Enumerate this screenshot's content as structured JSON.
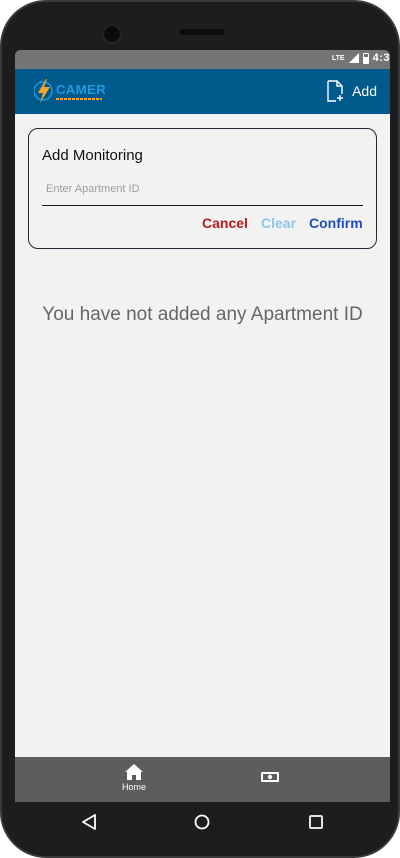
{
  "status_bar": {
    "network_label": "LTE",
    "time": "4:3"
  },
  "app_bar": {
    "logo_text": "CAMER",
    "add_label": "Add"
  },
  "add_monitoring": {
    "title": "Add Monitoring",
    "input_placeholder": "Enter Apartment ID",
    "input_value": "",
    "cancel_label": "Cancel",
    "clear_label": "Clear",
    "confirm_label": "Confirm"
  },
  "empty_state": {
    "message": "You have not added any Apartment ID"
  },
  "bottom_nav": {
    "items": [
      {
        "label": "Home",
        "icon": "home-icon"
      },
      {
        "label": "",
        "icon": "money-icon"
      }
    ]
  },
  "colors": {
    "app_bar": "#005a8c",
    "cancel": "#b71c1c",
    "clear": "#8fc5ea",
    "confirm": "#1e4fb5",
    "bottom_nav": "#5d5d5d"
  }
}
